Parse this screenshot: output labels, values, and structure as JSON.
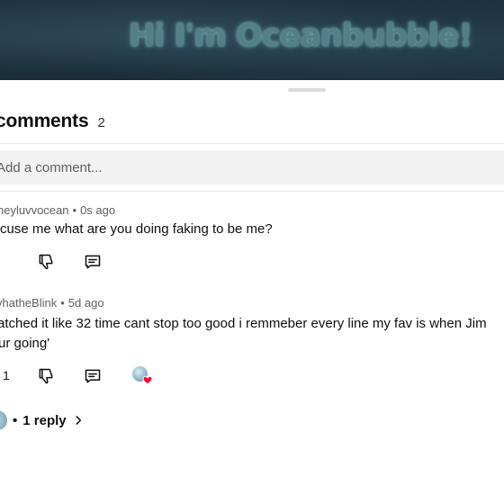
{
  "video": {
    "title_overlay": "Hi I'm Oceanbubble!"
  },
  "comments_panel": {
    "title": "comments",
    "count": "2",
    "add_comment_placeholder": "Add a comment...",
    "comments": [
      {
        "author": "heyluvvocean",
        "time": "0s ago",
        "text": "cuse me what are you doing faking to be me?"
      },
      {
        "author": "vhatheBlink",
        "time": "5d ago",
        "text_line1": "atched it like 32 time cant stop too good i remmeber every line my fav is when  Jim",
        "text_line2": "ur going'",
        "likes": "1"
      }
    ],
    "replies_label": "1 reply",
    "replies_sep": "•"
  },
  "colors": {
    "heart": "#ff0033",
    "secondary_text": "#606060",
    "input_bg": "#f2f2f2"
  },
  "icons": [
    "dislike-icon",
    "reply-icon",
    "creator-heart-icon",
    "chevron-right-icon"
  ]
}
